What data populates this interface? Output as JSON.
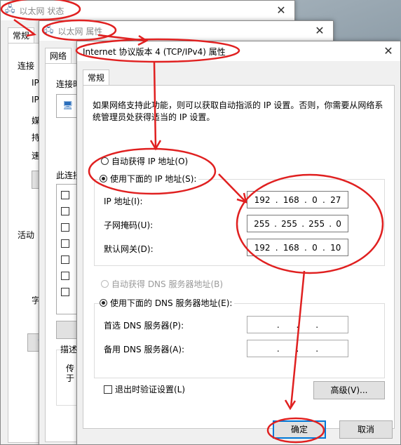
{
  "status_window": {
    "title": "以太网 状态",
    "tab": "常规",
    "left_labels": [
      "连接",
      "IP",
      "IP",
      "媒",
      "持",
      "速"
    ],
    "activity_label": "活动",
    "bytes_label": "字"
  },
  "props_window": {
    "title": "以太网 属性",
    "tab": "网络",
    "connect_using_label": "连接时",
    "items_label": "此连接",
    "description_label": "描述",
    "desc_lines": [
      "传",
      "于"
    ]
  },
  "ipv4_window": {
    "title": "Internet 协议版本 4 (TCP/IPv4) 属性",
    "tab": "常规",
    "intro": "如果网络支持此功能，则可以获取自动指派的 IP 设置。否则，你需要从网络系统管理员处获得适当的 IP 设置。",
    "auto_ip_label": "自动获得 IP 地址(O)",
    "manual_ip_label": "使用下面的 IP 地址(S):",
    "ip_address_label": "IP 地址(I):",
    "ip_address": [
      "192",
      "168",
      "0",
      "27"
    ],
    "subnet_label": "子网掩码(U):",
    "subnet": [
      "255",
      "255",
      "255",
      "0"
    ],
    "gateway_label": "默认网关(D):",
    "gateway": [
      "192",
      "168",
      "0",
      "10"
    ],
    "auto_dns_label": "自动获得 DNS 服务器地址(B)",
    "manual_dns_label": "使用下面的 DNS 服务器地址(E):",
    "preferred_dns_label": "首选 DNS 服务器(P):",
    "alternate_dns_label": "备用 DNS 服务器(A):",
    "validate_label": "退出时验证设置(L)",
    "advanced_label": "高级(V)...",
    "ok_label": "确定",
    "cancel_label": "取消",
    "dot": "."
  },
  "icons": [
    "network-adapter-icon",
    "close-icon",
    "shield-icon"
  ],
  "annotation_color": "#e02020"
}
